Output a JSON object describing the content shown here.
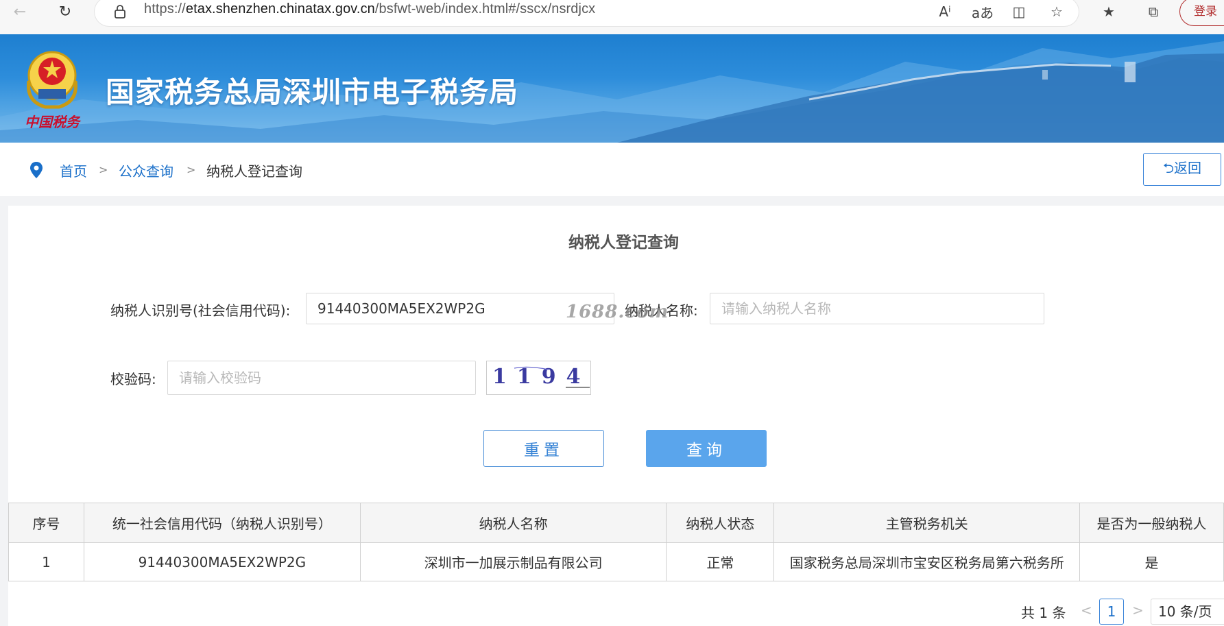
{
  "browser": {
    "url_prefix": "https://",
    "url_host": "etax.shenzhen.chinatax.gov.cn",
    "url_path": "/bsfwt-web/index.html#/sscx/nsrdjcx",
    "login_label": "登录"
  },
  "banner": {
    "title": "国家税务总局深圳市电子税务局",
    "emblem_text": "中国税务"
  },
  "breadcrumb": {
    "home": "首页",
    "separator": ">",
    "public_query": "公众查询",
    "current": "纳税人登记查询",
    "back_label": "⮌返回"
  },
  "form": {
    "title": "纳税人登记查询",
    "taxpayer_id_label": "纳税人识别号(社会信用代码):",
    "taxpayer_id_value": "91440300MA5EX2WP2G",
    "taxpayer_name_label": "纳税人名称:",
    "taxpayer_name_placeholder": "请输入纳税人名称",
    "captcha_label": "校验码:",
    "captcha_placeholder": "请输入校验码",
    "captcha_text": "1194",
    "watermark": "1688.com",
    "reset_label": "重置",
    "query_label": "查询"
  },
  "table": {
    "headers": [
      "序号",
      "统一社会信用代码（纳税人识别号）",
      "纳税人名称",
      "纳税人状态",
      "主管税务机关",
      "是否为一般纳税人"
    ],
    "rows": [
      [
        "1",
        "91440300MA5EX2WP2G",
        "深圳市一加展示制品有限公司",
        "正常",
        "国家税务总局深圳市宝安区税务局第六税务所",
        "是"
      ]
    ]
  },
  "pagination": {
    "total": "共 1 条",
    "prev": "<",
    "current_page": "1",
    "next": ">",
    "page_size": "10 条/页"
  }
}
